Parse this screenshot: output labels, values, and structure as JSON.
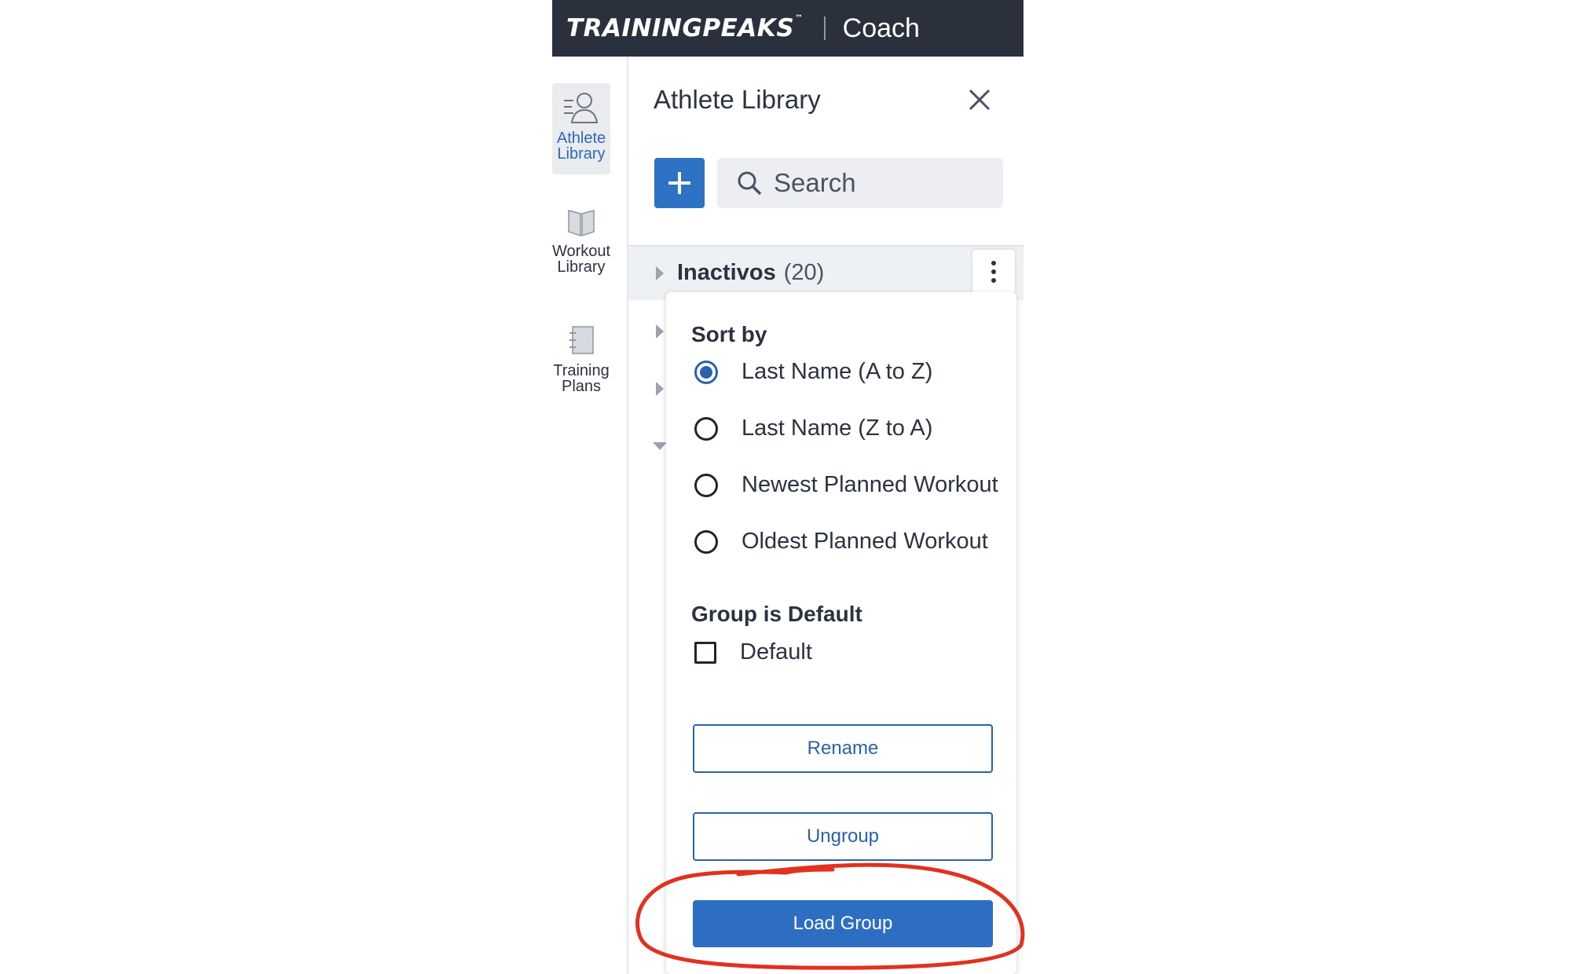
{
  "header": {
    "logo": "TRAININGPEAKS",
    "trademark": "™",
    "app_name": "Coach"
  },
  "rail": {
    "items": [
      {
        "label_line1": "Athlete",
        "label_line2": "Library",
        "icon": "athlete-library-icon",
        "active": true
      },
      {
        "label_line1": "Workout",
        "label_line2": "Library",
        "icon": "book-icon",
        "active": false
      },
      {
        "label_line1": "Training",
        "label_line2": "Plans",
        "icon": "notebook-icon",
        "active": false
      }
    ]
  },
  "panel": {
    "title": "Athlete Library",
    "search_placeholder": "Search",
    "group": {
      "name": "Inactivos",
      "count": "(20)"
    }
  },
  "menu": {
    "sort_heading": "Sort by",
    "sort_options": [
      {
        "label": "Last Name (A to Z)",
        "checked": true
      },
      {
        "label": "Last Name (Z to A)",
        "checked": false
      },
      {
        "label": "Newest Planned Workout",
        "checked": false
      },
      {
        "label": "Oldest Planned Workout",
        "checked": false
      }
    ],
    "default_heading": "Group is Default",
    "default_label": "Default",
    "default_checked": false,
    "rename_label": "Rename",
    "ungroup_label": "Ungroup",
    "load_label": "Load Group"
  },
  "colors": {
    "header_bg": "#2a313d",
    "accent": "#2d6ec3",
    "annotation": "#e0321e"
  }
}
